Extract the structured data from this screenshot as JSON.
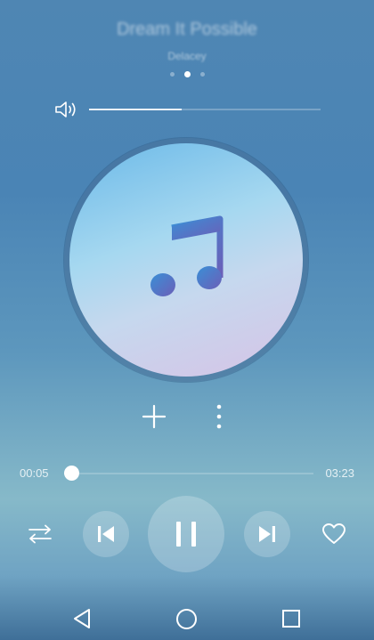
{
  "track": {
    "title": "Dream It Possible",
    "artist": "Delacey"
  },
  "pager": {
    "count": 3,
    "active_index": 1
  },
  "volume": {
    "level": 0.4
  },
  "playback": {
    "elapsed": "00:05",
    "duration": "03:23",
    "progress": 0.03,
    "state": "playing"
  },
  "icons": {
    "volume": "speaker-icon",
    "album": "music-note-icon",
    "add": "plus-icon",
    "more": "more-vertical-icon",
    "shuffle": "shuffle-icon",
    "previous": "skip-previous-icon",
    "pause": "pause-icon",
    "next": "skip-next-icon",
    "favorite": "heart-outline-icon",
    "nav_back": "back-triangle-icon",
    "nav_home": "home-circle-icon",
    "nav_recent": "recent-square-icon"
  },
  "colors": {
    "note_gradient_start": "#3a8fd6",
    "note_gradient_end": "#6b5fb8"
  }
}
